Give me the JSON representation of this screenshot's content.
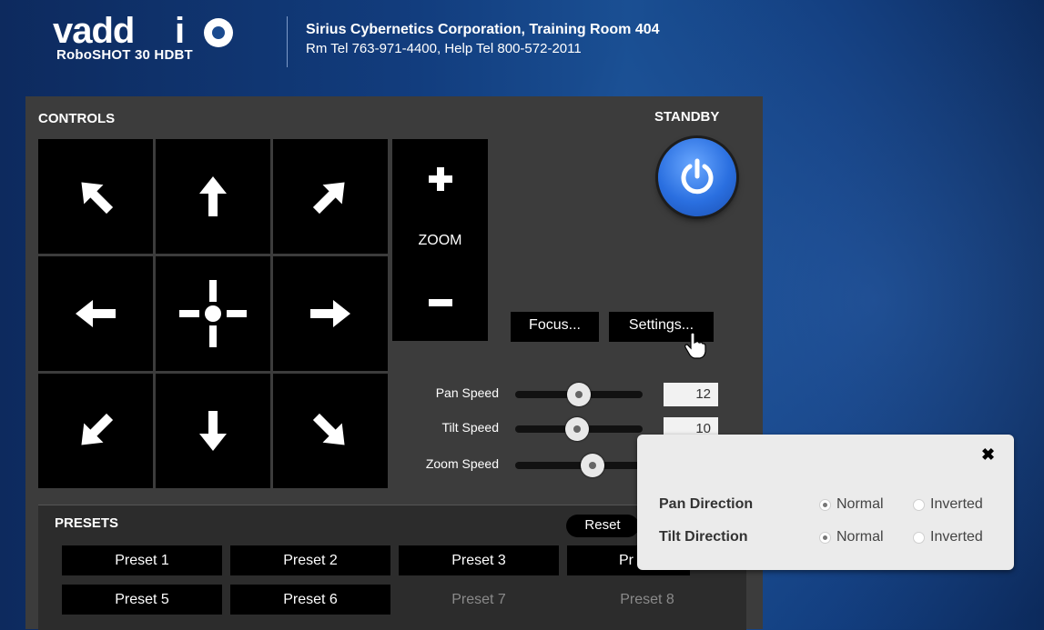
{
  "header": {
    "logo_text": "vaddio",
    "model": "RoboSHOT 30 HDBT",
    "room": "Sirius Cybernetics Corporation, Training Room 404",
    "contact": "Rm Tel 763-971-4400, Help Tel 800-572-2011"
  },
  "controls": {
    "title": "CONTROLS",
    "standby_title": "STANDBY",
    "zoom_label": "ZOOM",
    "focus_label": "Focus...",
    "settings_label": "Settings..."
  },
  "speeds": [
    {
      "label": "Pan Speed",
      "value": "12"
    },
    {
      "label": "Tilt Speed",
      "value": "10"
    },
    {
      "label": "Zoom Speed",
      "value": ""
    }
  ],
  "presets": {
    "title": "PRESETS",
    "reset_label": "Reset",
    "items": [
      "Preset 1",
      "Preset 2",
      "Preset 3",
      "Pr",
      "Preset 5",
      "Preset 6",
      "Preset 7",
      "Preset 8"
    ]
  },
  "settings_popup": {
    "close_glyph": "✖",
    "pan_label": "Pan Direction",
    "tilt_label": "Tilt Direction",
    "normal_label": "Normal",
    "inverted_label": "Inverted",
    "pan_selected": "Normal",
    "tilt_selected": "Normal"
  },
  "colors": {
    "accent": "#2a6fe0",
    "panel": "#3c3c3c",
    "background": "#123d7e"
  }
}
